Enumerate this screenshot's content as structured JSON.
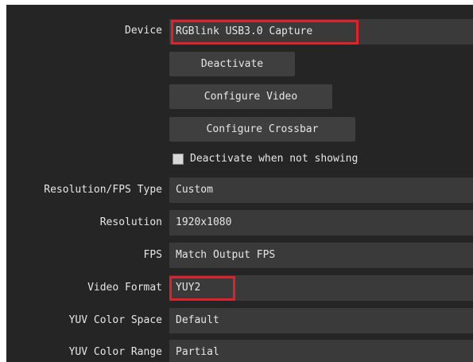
{
  "device": {
    "label": "Device",
    "value": "RGBlink USB3.0 Capture"
  },
  "buttons": {
    "deactivate": "Deactivate",
    "configure_video": "Configure Video",
    "configure_crossbar": "Configure Crossbar"
  },
  "deactivate_when_not_showing": {
    "label": "Deactivate when not showing",
    "checked": false
  },
  "resolution_fps_type": {
    "label": "Resolution/FPS Type",
    "value": "Custom"
  },
  "resolution": {
    "label": "Resolution",
    "value": "1920x1080"
  },
  "fps": {
    "label": "FPS",
    "value": "Match Output FPS"
  },
  "video_format": {
    "label": "Video Format",
    "value": "YUY2"
  },
  "yuv_color_space": {
    "label": "YUV Color Space",
    "value": "Default"
  },
  "yuv_color_range": {
    "label": "YUV Color Range",
    "value": "Partial"
  },
  "colors": {
    "panel_background": "#252525",
    "field_background": "#3a3a3a",
    "button_background": "#3f3f3f",
    "text": "#e6e6e6",
    "highlight": "#e0202b"
  }
}
